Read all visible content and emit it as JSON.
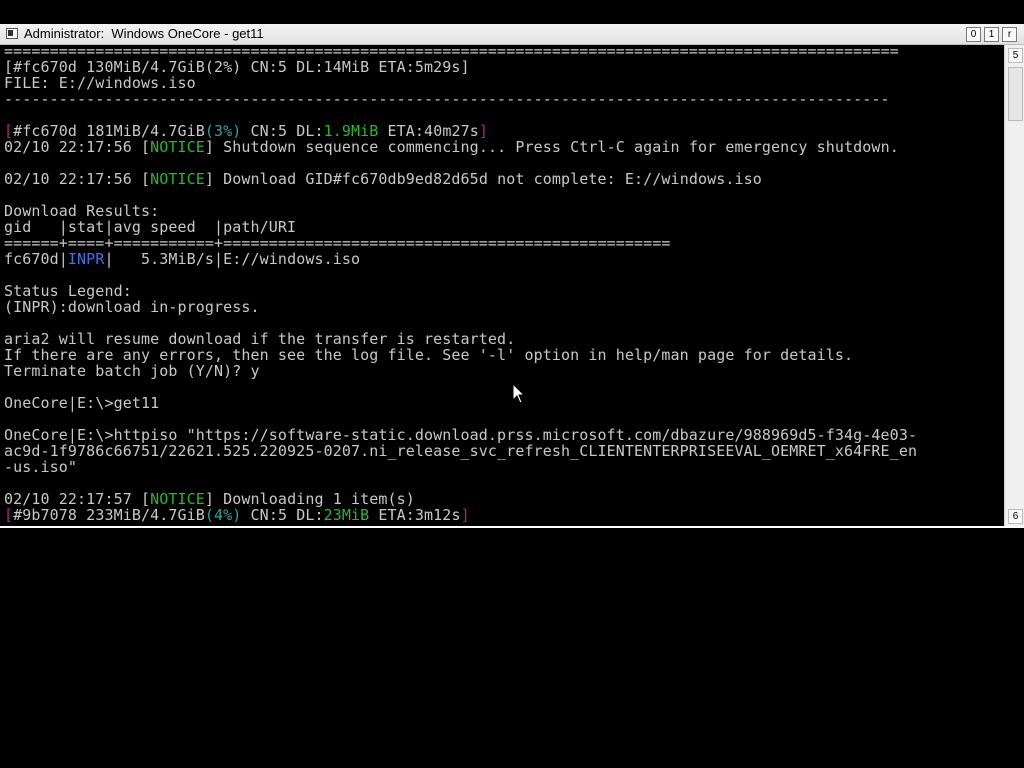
{
  "window": {
    "title": "Administrator:  Windows OneCore - get11",
    "buttons": {
      "minimize": "0",
      "maximize": "1",
      "restore": "r"
    }
  },
  "scrollbar": {
    "up": "5",
    "down": "6"
  },
  "console": {
    "sep_equals": "==================================================================================================",
    "progress1": "[#fc670d 130MiB/4.7GiB(2%) CN:5 DL:14MiB ETA:5m29s]",
    "file_line": "FILE: E://windows.iso",
    "sep_dashes": "-------------------------------------------------------------------------------------------------",
    "progress2": {
      "open": "[",
      "id": "#fc670d 181MiB/4.7GiB",
      "pct": "(3%)",
      "cn": " CN:5 DL:",
      "dl": "1.9MiB",
      "eta": " ETA:40m27s",
      "close": "]"
    },
    "notice1": {
      "prefix": "02/10 22:17:56 [",
      "tag": "NOTICE",
      "text": "] Shutdown sequence commencing... Press Ctrl-C again for emergency shutdown."
    },
    "notice2": {
      "prefix": "02/10 22:17:56 [",
      "tag": "NOTICE",
      "text": "] Download GID#fc670db9ed82d65d not complete: E://windows.iso"
    },
    "download_results": "Download Results:",
    "table_header": "gid   |stat|avg speed  |path/URI",
    "table_sep": "======+====+===========+=================================================",
    "table_row": {
      "gid": "fc670d|",
      "stat": "INPR",
      "rest": "|   5.3MiB/s|E://windows.iso"
    },
    "status_legend": "Status Legend:",
    "legend_inpr": "(INPR):download in-progress.",
    "resume_line": "aria2 will resume download if the transfer is restarted.",
    "errors_line": "If there are any errors, then see the log file. See '-l' option in help/man page for details.",
    "terminate_line": "Terminate batch job (Y/N)? y",
    "prompt_get11": "OneCore|E:\\>get11",
    "httpiso_1": "OneCore|E:\\>httpiso \"https://software-static.download.prss.microsoft.com/dbazure/988969d5-f34g-4e03-",
    "httpiso_2": "ac9d-1f9786c66751/22621.525.220925-0207.ni_release_svc_refresh_CLIENTENTERPRISEEVAL_OEMRET_x64FRE_en",
    "httpiso_3": "-us.iso\"",
    "notice3": {
      "prefix": "02/10 22:17:57 [",
      "tag": "NOTICE",
      "text": "] Downloading 1 item(s)"
    },
    "progress3": {
      "open": "[",
      "id": "#9b7078 233MiB/4.7GiB",
      "pct": "(4%)",
      "cn": " CN:5 DL:",
      "dl": "23MiB",
      "eta": " ETA:3m12s",
      "close": "]"
    }
  },
  "colors": {
    "background": "#000000",
    "text": "#c8c8c8",
    "magenta": "#b0208e",
    "cyan": "#26a3a5",
    "green": "#27b82c",
    "blue": "#4170e8"
  }
}
